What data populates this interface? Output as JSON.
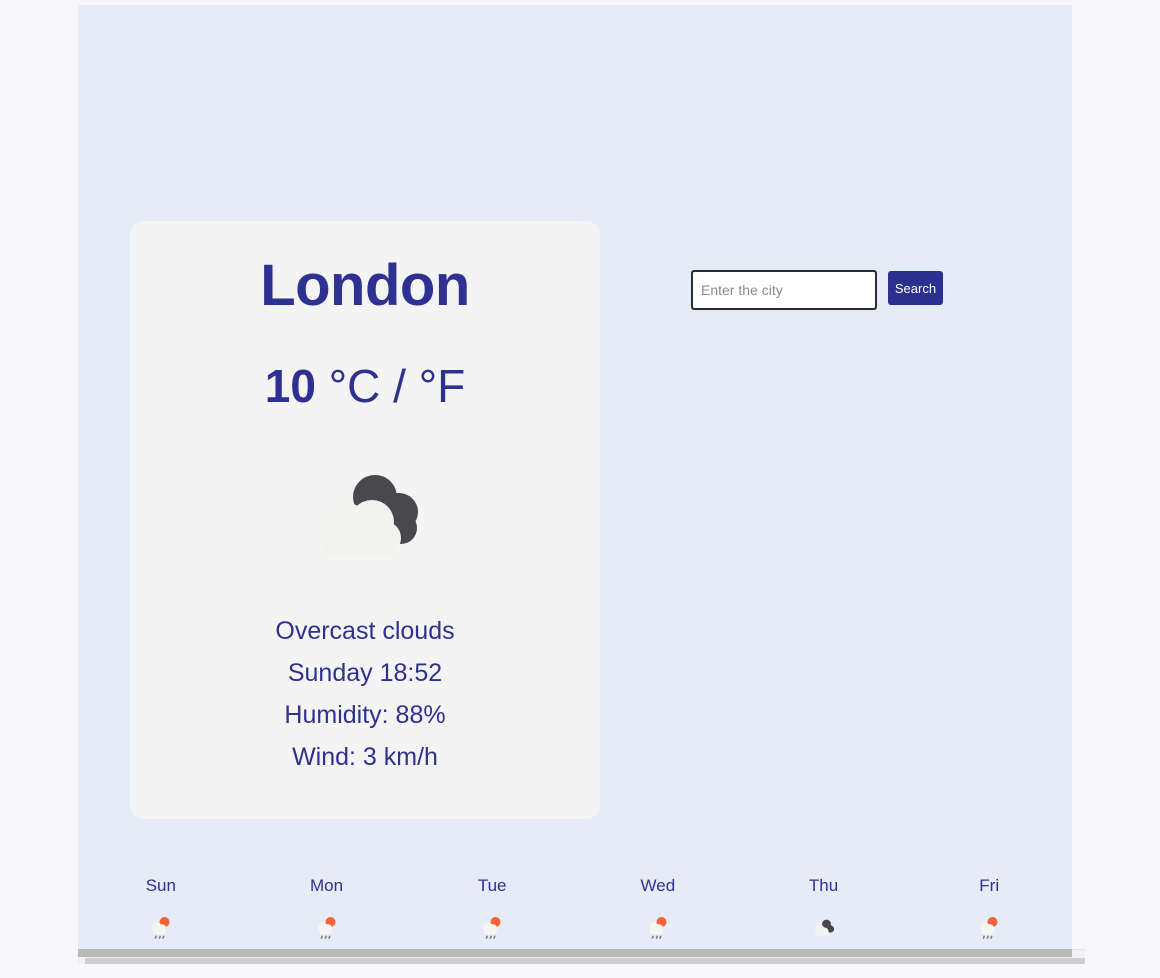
{
  "theme": {
    "page_background": "#f8f8fc",
    "container_background": "#e5ebf7",
    "card_background": "#f4f4f4",
    "accent_text": "#2e3191",
    "button_background": "#2b2f8f",
    "button_text": "#ffffff",
    "input_border": "#2b2b2b",
    "placeholder_text": "#8a8a95",
    "sun_color": "#f4633a",
    "dark_cloud": "#4a4a4f",
    "light_cloud": "#f2f2ee"
  },
  "current": {
    "city": "London",
    "temperature_value": "10",
    "temperature_units": "°C / °F",
    "icon": "overcast-clouds-icon",
    "condition": "Overcast clouds",
    "datetime": "Sunday 18:52",
    "humidity": "Humidity: 88%",
    "wind": "Wind: 3 km/h"
  },
  "search": {
    "value": "",
    "placeholder": "Enter the city",
    "button_label": "Search"
  },
  "forecast": {
    "days": [
      {
        "label": "Sun",
        "icon": "sun-behind-rain-cloud-icon"
      },
      {
        "label": "Mon",
        "icon": "sun-behind-rain-cloud-icon"
      },
      {
        "label": "Tue",
        "icon": "sun-behind-rain-cloud-icon"
      },
      {
        "label": "Wed",
        "icon": "sun-behind-rain-cloud-icon"
      },
      {
        "label": "Thu",
        "icon": "overcast-clouds-icon"
      },
      {
        "label": "Fri",
        "icon": "sun-behind-rain-cloud-icon"
      }
    ]
  }
}
